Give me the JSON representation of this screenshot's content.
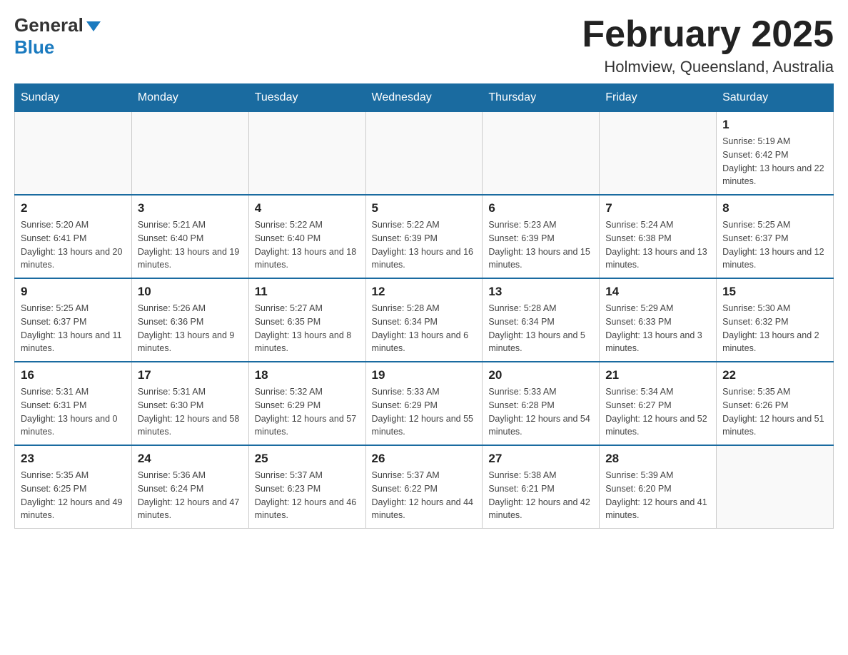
{
  "header": {
    "logo_general": "General",
    "logo_blue": "Blue",
    "month_title": "February 2025",
    "location": "Holmview, Queensland, Australia"
  },
  "days_of_week": [
    "Sunday",
    "Monday",
    "Tuesday",
    "Wednesday",
    "Thursday",
    "Friday",
    "Saturday"
  ],
  "weeks": [
    {
      "days": [
        {
          "number": "",
          "sunrise": "",
          "sunset": "",
          "daylight": "",
          "empty": true
        },
        {
          "number": "",
          "sunrise": "",
          "sunset": "",
          "daylight": "",
          "empty": true
        },
        {
          "number": "",
          "sunrise": "",
          "sunset": "",
          "daylight": "",
          "empty": true
        },
        {
          "number": "",
          "sunrise": "",
          "sunset": "",
          "daylight": "",
          "empty": true
        },
        {
          "number": "",
          "sunrise": "",
          "sunset": "",
          "daylight": "",
          "empty": true
        },
        {
          "number": "",
          "sunrise": "",
          "sunset": "",
          "daylight": "",
          "empty": true
        },
        {
          "number": "1",
          "sunrise": "Sunrise: 5:19 AM",
          "sunset": "Sunset: 6:42 PM",
          "daylight": "Daylight: 13 hours and 22 minutes.",
          "empty": false
        }
      ]
    },
    {
      "days": [
        {
          "number": "2",
          "sunrise": "Sunrise: 5:20 AM",
          "sunset": "Sunset: 6:41 PM",
          "daylight": "Daylight: 13 hours and 20 minutes.",
          "empty": false
        },
        {
          "number": "3",
          "sunrise": "Sunrise: 5:21 AM",
          "sunset": "Sunset: 6:40 PM",
          "daylight": "Daylight: 13 hours and 19 minutes.",
          "empty": false
        },
        {
          "number": "4",
          "sunrise": "Sunrise: 5:22 AM",
          "sunset": "Sunset: 6:40 PM",
          "daylight": "Daylight: 13 hours and 18 minutes.",
          "empty": false
        },
        {
          "number": "5",
          "sunrise": "Sunrise: 5:22 AM",
          "sunset": "Sunset: 6:39 PM",
          "daylight": "Daylight: 13 hours and 16 minutes.",
          "empty": false
        },
        {
          "number": "6",
          "sunrise": "Sunrise: 5:23 AM",
          "sunset": "Sunset: 6:39 PM",
          "daylight": "Daylight: 13 hours and 15 minutes.",
          "empty": false
        },
        {
          "number": "7",
          "sunrise": "Sunrise: 5:24 AM",
          "sunset": "Sunset: 6:38 PM",
          "daylight": "Daylight: 13 hours and 13 minutes.",
          "empty": false
        },
        {
          "number": "8",
          "sunrise": "Sunrise: 5:25 AM",
          "sunset": "Sunset: 6:37 PM",
          "daylight": "Daylight: 13 hours and 12 minutes.",
          "empty": false
        }
      ]
    },
    {
      "days": [
        {
          "number": "9",
          "sunrise": "Sunrise: 5:25 AM",
          "sunset": "Sunset: 6:37 PM",
          "daylight": "Daylight: 13 hours and 11 minutes.",
          "empty": false
        },
        {
          "number": "10",
          "sunrise": "Sunrise: 5:26 AM",
          "sunset": "Sunset: 6:36 PM",
          "daylight": "Daylight: 13 hours and 9 minutes.",
          "empty": false
        },
        {
          "number": "11",
          "sunrise": "Sunrise: 5:27 AM",
          "sunset": "Sunset: 6:35 PM",
          "daylight": "Daylight: 13 hours and 8 minutes.",
          "empty": false
        },
        {
          "number": "12",
          "sunrise": "Sunrise: 5:28 AM",
          "sunset": "Sunset: 6:34 PM",
          "daylight": "Daylight: 13 hours and 6 minutes.",
          "empty": false
        },
        {
          "number": "13",
          "sunrise": "Sunrise: 5:28 AM",
          "sunset": "Sunset: 6:34 PM",
          "daylight": "Daylight: 13 hours and 5 minutes.",
          "empty": false
        },
        {
          "number": "14",
          "sunrise": "Sunrise: 5:29 AM",
          "sunset": "Sunset: 6:33 PM",
          "daylight": "Daylight: 13 hours and 3 minutes.",
          "empty": false
        },
        {
          "number": "15",
          "sunrise": "Sunrise: 5:30 AM",
          "sunset": "Sunset: 6:32 PM",
          "daylight": "Daylight: 13 hours and 2 minutes.",
          "empty": false
        }
      ]
    },
    {
      "days": [
        {
          "number": "16",
          "sunrise": "Sunrise: 5:31 AM",
          "sunset": "Sunset: 6:31 PM",
          "daylight": "Daylight: 13 hours and 0 minutes.",
          "empty": false
        },
        {
          "number": "17",
          "sunrise": "Sunrise: 5:31 AM",
          "sunset": "Sunset: 6:30 PM",
          "daylight": "Daylight: 12 hours and 58 minutes.",
          "empty": false
        },
        {
          "number": "18",
          "sunrise": "Sunrise: 5:32 AM",
          "sunset": "Sunset: 6:29 PM",
          "daylight": "Daylight: 12 hours and 57 minutes.",
          "empty": false
        },
        {
          "number": "19",
          "sunrise": "Sunrise: 5:33 AM",
          "sunset": "Sunset: 6:29 PM",
          "daylight": "Daylight: 12 hours and 55 minutes.",
          "empty": false
        },
        {
          "number": "20",
          "sunrise": "Sunrise: 5:33 AM",
          "sunset": "Sunset: 6:28 PM",
          "daylight": "Daylight: 12 hours and 54 minutes.",
          "empty": false
        },
        {
          "number": "21",
          "sunrise": "Sunrise: 5:34 AM",
          "sunset": "Sunset: 6:27 PM",
          "daylight": "Daylight: 12 hours and 52 minutes.",
          "empty": false
        },
        {
          "number": "22",
          "sunrise": "Sunrise: 5:35 AM",
          "sunset": "Sunset: 6:26 PM",
          "daylight": "Daylight: 12 hours and 51 minutes.",
          "empty": false
        }
      ]
    },
    {
      "days": [
        {
          "number": "23",
          "sunrise": "Sunrise: 5:35 AM",
          "sunset": "Sunset: 6:25 PM",
          "daylight": "Daylight: 12 hours and 49 minutes.",
          "empty": false
        },
        {
          "number": "24",
          "sunrise": "Sunrise: 5:36 AM",
          "sunset": "Sunset: 6:24 PM",
          "daylight": "Daylight: 12 hours and 47 minutes.",
          "empty": false
        },
        {
          "number": "25",
          "sunrise": "Sunrise: 5:37 AM",
          "sunset": "Sunset: 6:23 PM",
          "daylight": "Daylight: 12 hours and 46 minutes.",
          "empty": false
        },
        {
          "number": "26",
          "sunrise": "Sunrise: 5:37 AM",
          "sunset": "Sunset: 6:22 PM",
          "daylight": "Daylight: 12 hours and 44 minutes.",
          "empty": false
        },
        {
          "number": "27",
          "sunrise": "Sunrise: 5:38 AM",
          "sunset": "Sunset: 6:21 PM",
          "daylight": "Daylight: 12 hours and 42 minutes.",
          "empty": false
        },
        {
          "number": "28",
          "sunrise": "Sunrise: 5:39 AM",
          "sunset": "Sunset: 6:20 PM",
          "daylight": "Daylight: 12 hours and 41 minutes.",
          "empty": false
        },
        {
          "number": "",
          "sunrise": "",
          "sunset": "",
          "daylight": "",
          "empty": true
        }
      ]
    }
  ]
}
